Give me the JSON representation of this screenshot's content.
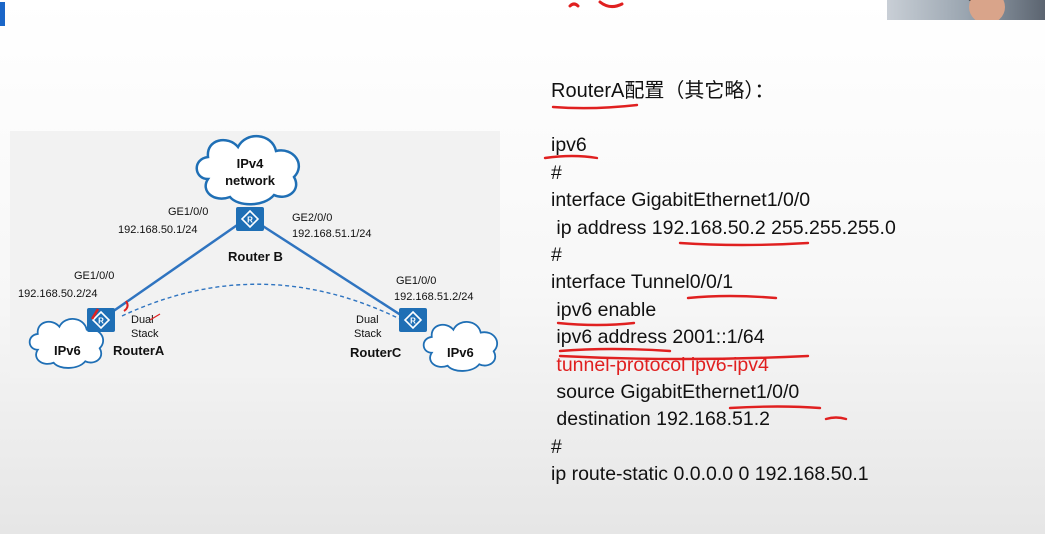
{
  "slide": {
    "config_title": "RouterA配置（其它略）：",
    "config_lines": [
      {
        "text": "ipv6",
        "highlight": false
      },
      {
        "text": "#",
        "highlight": false
      },
      {
        "text": "interface GigabitEthernet1/0/0",
        "highlight": false
      },
      {
        "text": " ip address 192.168.50.2 255.255.255.0",
        "highlight": false
      },
      {
        "text": "#",
        "highlight": false
      },
      {
        "text": "interface Tunnel0/0/1",
        "highlight": false
      },
      {
        "text": " ipv6 enable",
        "highlight": false
      },
      {
        "text": " ipv6 address 2001::1/64",
        "highlight": false
      },
      {
        "text": " tunnel-protocol ipv6-ipv4",
        "highlight": true
      },
      {
        "text": " source GigabitEthernet1/0/0",
        "highlight": false
      },
      {
        "text": " destination 192.168.51.2",
        "highlight": false
      },
      {
        "text": "#",
        "highlight": false
      },
      {
        "text": "ip route-static 0.0.0.0 0 192.168.50.1",
        "highlight": false
      }
    ],
    "highlight_color": "#e02020"
  },
  "diagram": {
    "cloud_ipv4_line1": "IPv4",
    "cloud_ipv4_line2": "network",
    "routerB_left_port": "GE1/0/0",
    "routerB_left_ip": "192.168.50.1/24",
    "routerB_right_port": "GE2/0/0",
    "routerB_right_ip": "192.168.51.1/24",
    "routerB_name": "Router B",
    "routerA_port": "GE1/0/0",
    "routerA_ip": "192.168.50.2/24",
    "routerA_stack_1": "Dual",
    "routerA_stack_2": "Stack",
    "routerA_name": "RouterA",
    "routerC_port": "GE1/0/0",
    "routerC_ip": "192.168.51.2/24",
    "routerC_stack_1": "Dual",
    "routerC_stack_2": "Stack",
    "routerC_name": "RouterC",
    "cloud_ipv6_left": "IPv6",
    "cloud_ipv6_right": "IPv6",
    "router_color": "#1f6fb5",
    "link_color": "#2f74c0"
  }
}
